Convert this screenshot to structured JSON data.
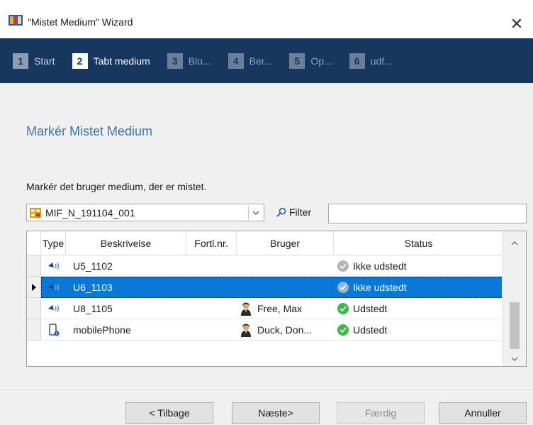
{
  "window": {
    "title": "\"Mistet Medium\" Wizard",
    "close_glyph": "✕"
  },
  "steps": [
    {
      "num": "1",
      "label": "Start",
      "state": "done"
    },
    {
      "num": "2",
      "label": "Tabt medium",
      "state": "active"
    },
    {
      "num": "3",
      "label": "Blo...",
      "state": "pending"
    },
    {
      "num": "4",
      "label": "Ber...",
      "state": "pending"
    },
    {
      "num": "5",
      "label": "Op...",
      "state": "pending"
    },
    {
      "num": "6",
      "label": "udf...",
      "state": "pending"
    }
  ],
  "page": {
    "title": "Markér Mistet Medium",
    "instruction": "Markér det bruger medium, der er mistet."
  },
  "medium_select": {
    "value": "MIF_N_191104_001"
  },
  "filter": {
    "label": "Filter",
    "value": ""
  },
  "grid": {
    "columns": [
      "Type",
      "Beskrivelse",
      "Fortl.nr.",
      "Bruger",
      "Status"
    ],
    "rows": [
      {
        "type_icon": "transponder-icon",
        "beskrivelse": "U5_1102",
        "fortl": "",
        "bruger": "",
        "user_icon": false,
        "status": "Ikke udstedt",
        "status_icon": "gray-check-icon",
        "selected": false,
        "current": false
      },
      {
        "type_icon": "transponder-icon",
        "beskrivelse": "U6_1103",
        "fortl": "",
        "bruger": "",
        "user_icon": false,
        "status": "Ikke udstedt",
        "status_icon": "gray-check-icon",
        "selected": true,
        "current": true
      },
      {
        "type_icon": "transponder-icon",
        "beskrivelse": "U8_1105",
        "fortl": "",
        "bruger": "Free, Max",
        "user_icon": true,
        "status": "Udstedt",
        "status_icon": "green-check-icon",
        "selected": false,
        "current": false
      },
      {
        "type_icon": "mobile-phone-icon",
        "beskrivelse": "mobilePhone",
        "fortl": "",
        "bruger": "Duck, Don...",
        "user_icon": true,
        "status": "Udstedt",
        "status_icon": "green-check-icon",
        "selected": false,
        "current": false
      }
    ]
  },
  "buttons": {
    "back": "< Tilbage",
    "next": "Næste>",
    "finish": "Færdig",
    "cancel": "Annuller"
  },
  "colors": {
    "step_bar": "#17375e",
    "title_accent": "#3a76b0",
    "selection": "#0a78d7",
    "status_ok": "#3cb84b",
    "status_gray": "#b4b4b4"
  }
}
